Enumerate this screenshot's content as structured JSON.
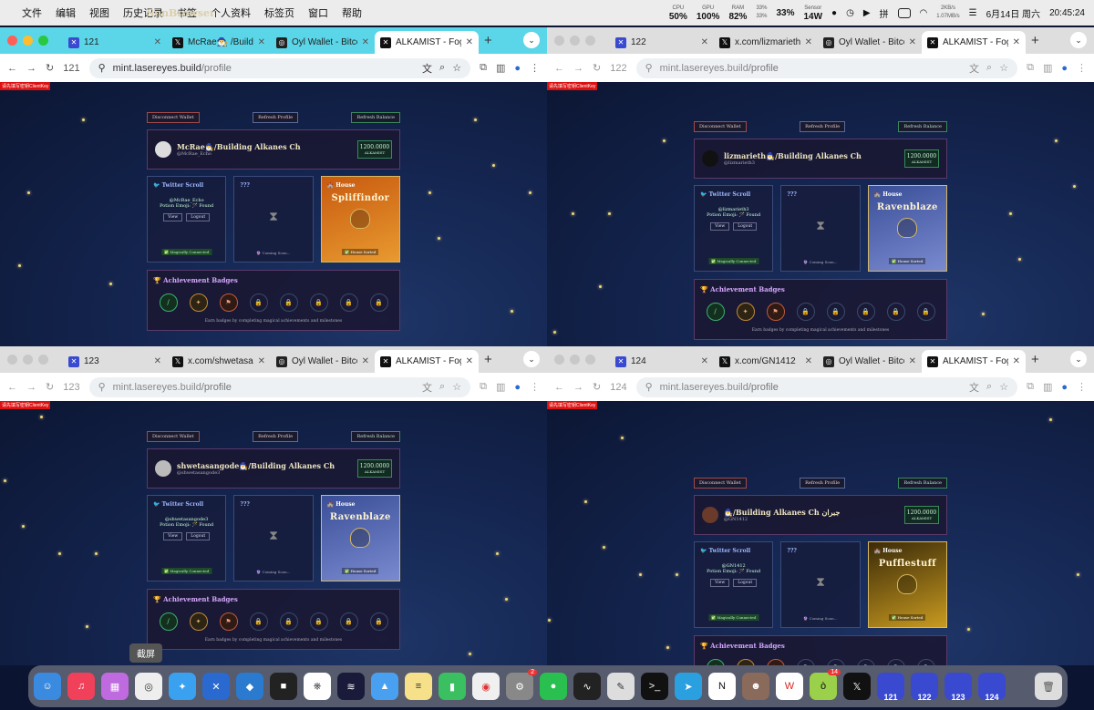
{
  "menubar": {
    "app": "SunBrowser",
    "items": [
      "文件",
      "编辑",
      "视图",
      "历史记录",
      "书签",
      "个人资料",
      "标签页",
      "窗口",
      "帮助"
    ],
    "cpu_l": "CPU",
    "cpu": "50%",
    "gpu_l": "GPU",
    "gpu": "100%",
    "ram_l": "RAM",
    "ram": "82%",
    "swap1": "33%",
    "swap2": "33%",
    "swap": "33%",
    "sensor_l": "Sensor",
    "sensor": "14W",
    "net_up": "2KB/s",
    "net_down": "1.07MB/s",
    "date": "6月14日 周六",
    "time": "20:45:24"
  },
  "windows": [
    {
      "profile_num": "121",
      "tabs": [
        "121",
        "McRae🧙‍♂️ /Build",
        "Oyl Wallet - Bitcoi",
        "ALKAMIST - FogW"
      ],
      "url_host": "mint.lasereyes.build",
      "url_path": "/profile",
      "user": {
        "name": "McRae🧙‍♂️/Building Alkanes Ch",
        "handle": "@McRae_Echo",
        "potion": "Potion Emoji: 🪄 Found",
        "house": "Spliffindor"
      }
    },
    {
      "profile_num": "122",
      "tabs": [
        "122",
        "x.com/lizmarieth3",
        "Oyl Wallet - Bitcoi",
        "ALKAMIST - FogW"
      ],
      "url_host": "mint.lasereyes.build",
      "url_path": "/profile",
      "user": {
        "name": "lizmarieth🧙‍♂️/Building Alkanes Ch",
        "handle": "@lizmarieth3",
        "potion": "Potion Emoji: 🪄 Found",
        "house": "Ravenblaze"
      }
    },
    {
      "profile_num": "123",
      "tabs": [
        "123",
        "x.com/shwetasan",
        "Oyl Wallet - Bitcoi",
        "ALKAMIST - FogW"
      ],
      "url_host": "mint.lasereyes.build",
      "url_path": "/profile",
      "user": {
        "name": "shwetasangode🧙‍♂️/Building Alkanes Ch",
        "handle": "@shwetasangode3",
        "potion": "Potion Emoji: 🪄 Found",
        "house": "Ravenblaze"
      }
    },
    {
      "profile_num": "124",
      "tabs": [
        "124",
        "x.com/GN1412",
        "Oyl Wallet - Bitcoi",
        "ALKAMIST - FogW"
      ],
      "url_host": "mint.lasereyes.build",
      "url_path": "/profile",
      "user": {
        "name": "🧙‍♂️/Building Alkanes Ch جبران",
        "handle": "@GN1412",
        "potion": "Potion Emoji: 🪄 Found",
        "house": "Pufflestuff"
      }
    }
  ],
  "app": {
    "red_tag": "请先填写密钥ClientKey",
    "disconnect": "Disconnect Wallet",
    "refresh_profile": "Refresh Profile",
    "refresh_balance": "Refresh Balance",
    "balance": "1200.0000",
    "balance_unit": "ALKAMIST",
    "twitter_title": "Twitter Scroll",
    "view": "View",
    "logout": "Logout",
    "connected": "✅ Magically Connected",
    "unknown_title": "???",
    "coming": "🔮 Coming Soon...",
    "house_title": "House",
    "sorted": "✅ House Sorted",
    "achv_title": "🏆 Achievement Badges",
    "achv_foot": "Earn badges by completing magical achievements and milestones"
  },
  "colors": {
    "spliffindor": "#d9781a",
    "ravenblaze": "#4a5fa8",
    "pufflestuff": "#8a6a10",
    "active_tab": "#5bd6e8"
  },
  "dock": {
    "tooltip": "截屏",
    "badge_settings": "2",
    "badge_app": "14",
    "labels": [
      "121",
      "122",
      "123",
      "124"
    ]
  }
}
